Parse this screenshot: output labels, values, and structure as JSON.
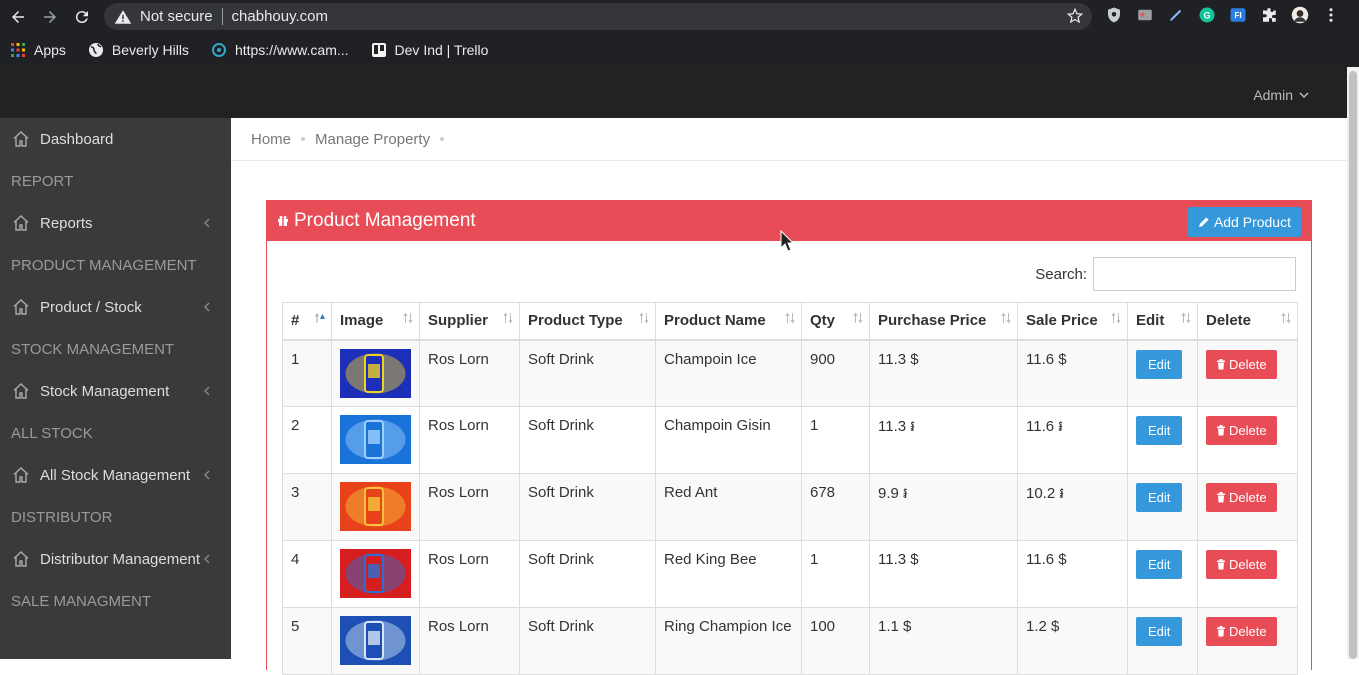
{
  "browser": {
    "security_label": "Not secure",
    "url": "chabhouy.com",
    "bookmarks": [
      {
        "label": "Apps",
        "icon": "apps-grid-icon"
      },
      {
        "label": "Beverly Hills",
        "icon": "globe-icon"
      },
      {
        "label": "https://www.cam...",
        "icon": "site-icon"
      },
      {
        "label": "Dev Ind | Trello",
        "icon": "trello-icon"
      }
    ]
  },
  "header": {
    "user_menu": "Admin"
  },
  "sidebar": {
    "items": [
      {
        "type": "link",
        "label": "Dashboard"
      },
      {
        "type": "header",
        "label": "REPORT"
      },
      {
        "type": "link",
        "label": "Reports",
        "submenu": true
      },
      {
        "type": "header",
        "label": "PRODUCT MANAGEMENT"
      },
      {
        "type": "link",
        "label": "Product / Stock",
        "submenu": true
      },
      {
        "type": "header",
        "label": "STOCK MANAGEMENT"
      },
      {
        "type": "link",
        "label": "Stock Management",
        "submenu": true
      },
      {
        "type": "header",
        "label": "ALL STOCK"
      },
      {
        "type": "link",
        "label": "All Stock Management",
        "submenu": true
      },
      {
        "type": "header",
        "label": "DISTRIBUTOR"
      },
      {
        "type": "link",
        "label": "Distributor Management",
        "submenu": true
      },
      {
        "type": "header",
        "label": "SALE MANAGMENT"
      }
    ]
  },
  "breadcrumb": [
    "Home",
    "Manage Property"
  ],
  "panel": {
    "title": "Product Management",
    "add_button": "Add Product",
    "search_label": "Search:",
    "search_value": ""
  },
  "table": {
    "columns": [
      "#",
      "Image",
      "Supplier",
      "Product Type",
      "Product Name",
      "Qty",
      "Purchase Price",
      "Sale Price",
      "Edit",
      "Delete"
    ],
    "rows": [
      {
        "no": "1",
        "supplier": "Ros Lorn",
        "type": "Soft Drink",
        "name": "Champoin Ice",
        "qty": "900",
        "purchase": "11.3 $",
        "sale": "11.6 $",
        "img_colors": [
          "#1d2fb8",
          "#f0d020"
        ]
      },
      {
        "no": "2",
        "supplier": "Ros Lorn",
        "type": "Soft Drink",
        "name": "Champoin Gisin",
        "qty": "1",
        "purchase": "11.3 ៛",
        "sale": "11.6 ៛",
        "img_colors": [
          "#1a73d8",
          "#9fd0ff"
        ]
      },
      {
        "no": "3",
        "supplier": "Ros Lorn",
        "type": "Soft Drink",
        "name": "Red Ant",
        "qty": "678",
        "purchase": "9.9 ៛",
        "sale": "10.2 ៛",
        "img_colors": [
          "#e8421a",
          "#f7c33b"
        ]
      },
      {
        "no": "4",
        "supplier": "Ros Lorn",
        "type": "Soft Drink",
        "name": "Red King Bee",
        "qty": "1",
        "purchase": "11.3 $",
        "sale": "11.6 $",
        "img_colors": [
          "#d61e1e",
          "#2a6fd6"
        ]
      },
      {
        "no": "5",
        "supplier": "Ros Lorn",
        "type": "Soft Drink",
        "name": "Ring Champion Ice",
        "qty": "100",
        "purchase": "1.1 $",
        "sale": "1.2 $",
        "img_colors": [
          "#1d4fb5",
          "#d8e6f5"
        ]
      }
    ],
    "edit_label": "Edit",
    "delete_label": "Delete"
  }
}
